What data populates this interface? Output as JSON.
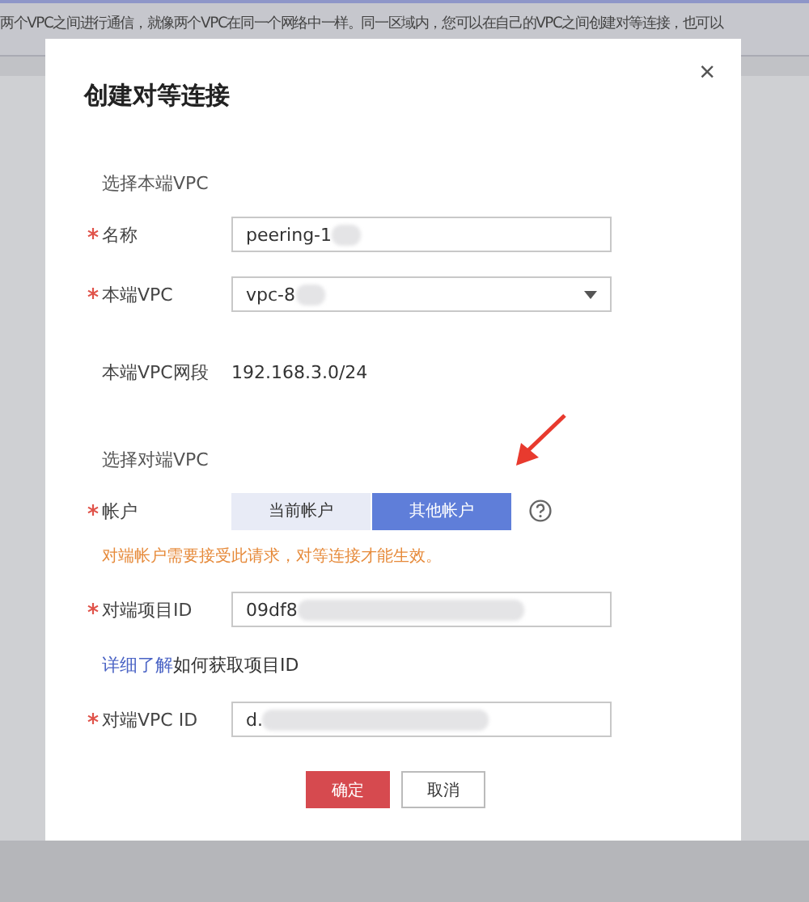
{
  "background_banner": {
    "text": "两个VPC之间进行通信，就像两个VPC在同一个网络中一样。同一区域内，您可以在自己的VPC之间创建对等连接，也可以"
  },
  "dialog": {
    "title": "创建对等连接",
    "close": "×",
    "sections": [
      {
        "heading": "选择本端VPC",
        "rows": [
          {
            "kind": "input",
            "required": true,
            "label": "名称",
            "value": "peering-1",
            "redacted": true
          },
          {
            "kind": "select",
            "required": true,
            "label": "本端VPC",
            "value": "vpc-8",
            "redacted": true
          },
          {
            "kind": "static",
            "required": false,
            "label": "本端VPC网段",
            "value": "192.168.3.0/24"
          }
        ]
      },
      {
        "heading": "选择对端VPC",
        "rows": [
          {
            "kind": "toggle",
            "required": true,
            "label": "帐户",
            "options": [
              {
                "label": "当前帐户",
                "selected": false
              },
              {
                "label": "其他帐户",
                "selected": true
              }
            ]
          },
          {
            "kind": "warning",
            "text": "对端帐户需要接受此请求，对等连接才能生效。"
          },
          {
            "kind": "input",
            "required": true,
            "label": "对端项目ID",
            "value": "09df8",
            "redacted": true
          },
          {
            "kind": "link",
            "link": "详细了解",
            "text": "如何获取项目ID"
          },
          {
            "kind": "input",
            "required": true,
            "label": "对端VPC ID",
            "value": "d.",
            "redacted": true
          }
        ]
      }
    ],
    "buttons": [
      {
        "label": "确定",
        "primary": true
      },
      {
        "label": "取消",
        "primary": false
      }
    ]
  }
}
